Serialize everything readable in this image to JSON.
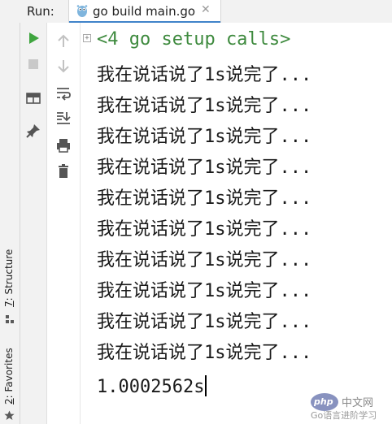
{
  "run_label": "Run:",
  "tab": {
    "title": "go build main.go",
    "close": "✕"
  },
  "sidebar": {
    "structure": {
      "num": "7",
      "label": ": Structure"
    },
    "favorites": {
      "num": "2",
      "label": ": Favorites"
    }
  },
  "console": {
    "fold_symbol": "+",
    "setup_line": "<4 go setup calls>",
    "lines": [
      "我在说话说了1s说完了...",
      "我在说话说了1s说完了...",
      "我在说话说了1s说完了...",
      "我在说话说了1s说完了...",
      "我在说话说了1s说完了...",
      "我在说话说了1s说完了...",
      "我在说话说了1s说完了...",
      "我在说话说了1s说完了...",
      "我在说话说了1s说完了...",
      "我在说话说了1s说完了..."
    ],
    "elapsed": "1.0002562s"
  },
  "watermark": {
    "logo": "php",
    "cn": "中文网",
    "bottom": "Go语言进阶学习"
  },
  "colors": {
    "run_green": "#3fa53f",
    "tab_accent": "#4083c9",
    "setup_green": "#3e8a3e"
  }
}
